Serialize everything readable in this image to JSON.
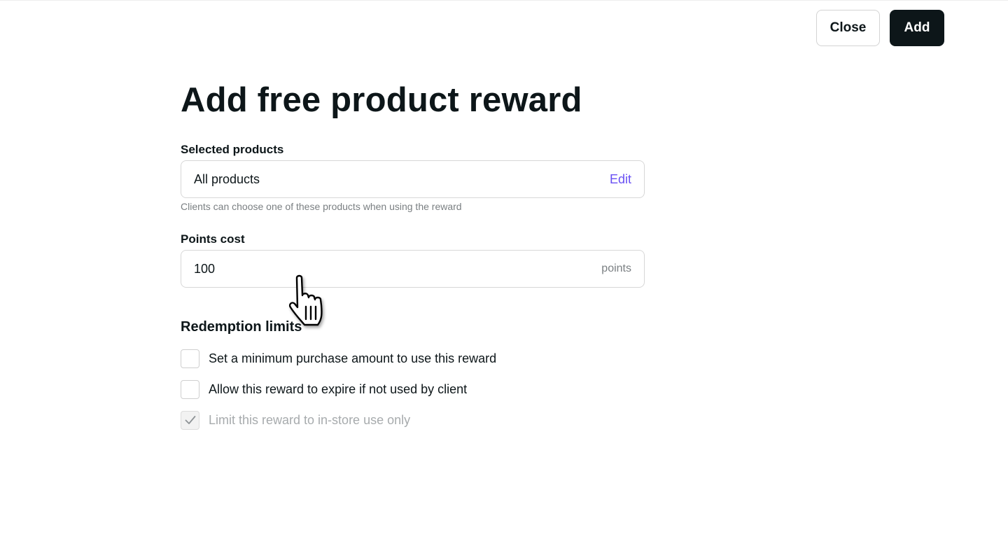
{
  "header": {
    "close_label": "Close",
    "add_label": "Add"
  },
  "page": {
    "title": "Add free product reward"
  },
  "selected_products": {
    "label": "Selected products",
    "value": "All products",
    "edit_label": "Edit",
    "helper": "Clients can choose one of these products when using the reward"
  },
  "points_cost": {
    "label": "Points cost",
    "value": "100",
    "suffix": "points"
  },
  "redemption_limits": {
    "title": "Redemption limits",
    "options": [
      {
        "label": "Set a minimum purchase amount to use this reward",
        "checked": false,
        "disabled": false
      },
      {
        "label": "Allow this reward to expire if not used by client",
        "checked": false,
        "disabled": false
      },
      {
        "label": "Limit this reward to in-store use only",
        "checked": true,
        "disabled": true
      }
    ]
  },
  "colors": {
    "primary": "#0d1619",
    "accent": "#6950f3",
    "muted": "#7a7f82",
    "border": "#d7d7d7"
  },
  "icons": {
    "checkmark": "checkmark-icon",
    "cursor": "hand-pointer-cursor-icon"
  }
}
